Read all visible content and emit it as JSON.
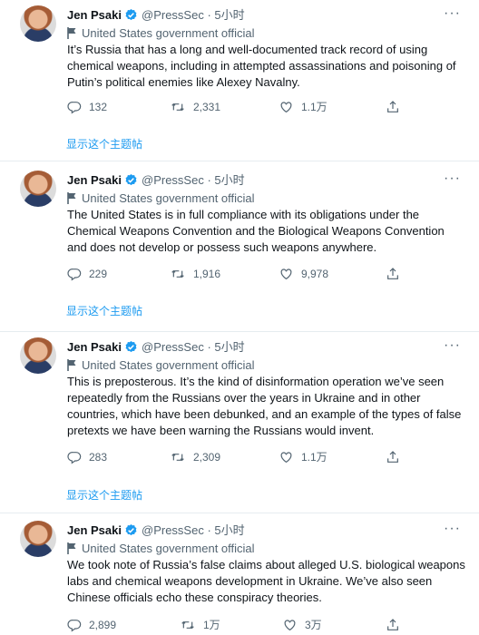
{
  "labels": {
    "author_name": "Jen Psaki",
    "author_handle": "@PressSec",
    "dot": "·",
    "time": "5小时",
    "gov_label": "United States government official",
    "show_thread": "显示这个主题帖",
    "more": "···"
  },
  "tweets": [
    {
      "text": "It’s Russia that has a long and well-documented track record of using chemical weapons, including in attempted assassinations and poisoning of Putin’s political enemies like Alexey Navalny.",
      "replies": "132",
      "retweets": "2,331",
      "likes": "1.1万"
    },
    {
      "text": "The United States is in full compliance with its obligations under the Chemical Weapons Convention and the Biological Weapons Convention and does not develop or possess such weapons anywhere.",
      "replies": "229",
      "retweets": "1,916",
      "likes": "9,978"
    },
    {
      "text": "This is preposterous. It’s the kind of disinformation operation we’ve seen repeatedly from the Russians over the years in Ukraine and in other countries, which have been debunked, and an example of the types of false pretexts we have been warning the Russians would invent.",
      "replies": "283",
      "retweets": "2,309",
      "likes": "1.1万"
    },
    {
      "text": "We took note of Russia’s false claims about alleged U.S. biological weapons labs and chemical weapons development in Ukraine.  We’ve also seen Chinese officials echo these conspiracy theories.",
      "replies": "2,899",
      "retweets": "1万",
      "likes": "3万"
    }
  ],
  "colors": {
    "link": "#1d9bf0",
    "muted": "#536471",
    "verified": "#1d9bf0",
    "divider": "#e6ecf0"
  },
  "icons": [
    "verified-badge-icon",
    "flag-icon",
    "reply-icon",
    "retweet-icon",
    "like-icon",
    "share-icon",
    "more-icon"
  ]
}
